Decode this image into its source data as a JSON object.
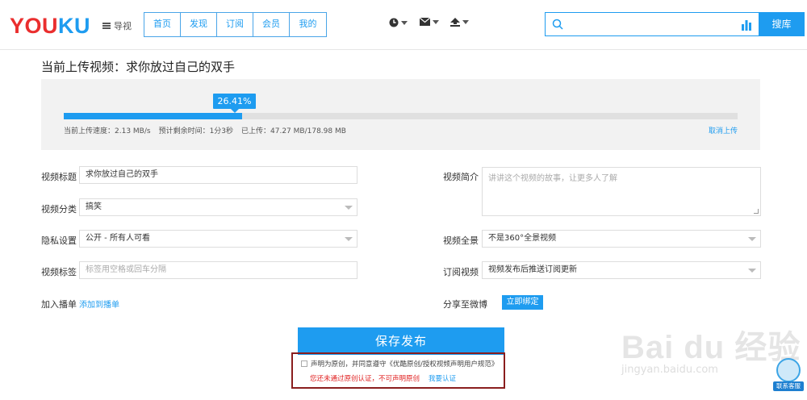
{
  "header": {
    "logo_you": "YOU",
    "logo_ku": "KU",
    "guide_label": "导视",
    "nav": [
      "首页",
      "发现",
      "订阅",
      "会员",
      "我的"
    ],
    "search_placeholder": "",
    "search_button": "搜库",
    "icons": [
      "clock-icon",
      "mail-icon",
      "upload-icon",
      "search-icon",
      "bar-chart-icon"
    ]
  },
  "upload": {
    "title": "当前上传视频：求你放过自己的双手",
    "progress_label": "26.41%",
    "progress_fraction": 0.2641,
    "speed": "当前上传速度：2.13 MB/s",
    "remaining": "预计剩余时间：1分3秒",
    "uploaded": "已上传：47.27 MB/178.98 MB",
    "cancel": "取消上传"
  },
  "form": {
    "title_label": "视频标题",
    "title_value": "求你放过自己的双手",
    "category_label": "视频分类",
    "category_value": "搞笑",
    "privacy_label": "隐私设置",
    "privacy_value": "公开 - 所有人可看",
    "tags_label": "视频标签",
    "tags_placeholder": "标签用空格或回车分隔",
    "playlist_label": "加入播单",
    "playlist_link": "添加到播单",
    "desc_label": "视频简介",
    "desc_placeholder": "讲讲这个视频的故事，让更多人了解",
    "panorama_label": "视频全景",
    "panorama_value": "不是360°全景视频",
    "subscribe_label": "订阅视频",
    "subscribe_value": "视频发布后推送订阅更新",
    "weibo_label": "分享至微博",
    "weibo_button": "立即绑定"
  },
  "publish": {
    "button": "保存发布",
    "declare": "声明为原创，并同意遵守《优酷原创/授权视频声明用户规范》",
    "warning": "您还未通过原创认证，不可声明原创",
    "verify_link": "我要认证"
  },
  "watermark": {
    "brand": "Bai du 经验",
    "url": "jingyan.baidu.com"
  },
  "help": {
    "label": "联系客服"
  },
  "colors": {
    "accent": "#1e9cf0",
    "logo_red": "#ea2e2e",
    "warning": "#e02020",
    "highlight_border": "#8a1e1e"
  }
}
